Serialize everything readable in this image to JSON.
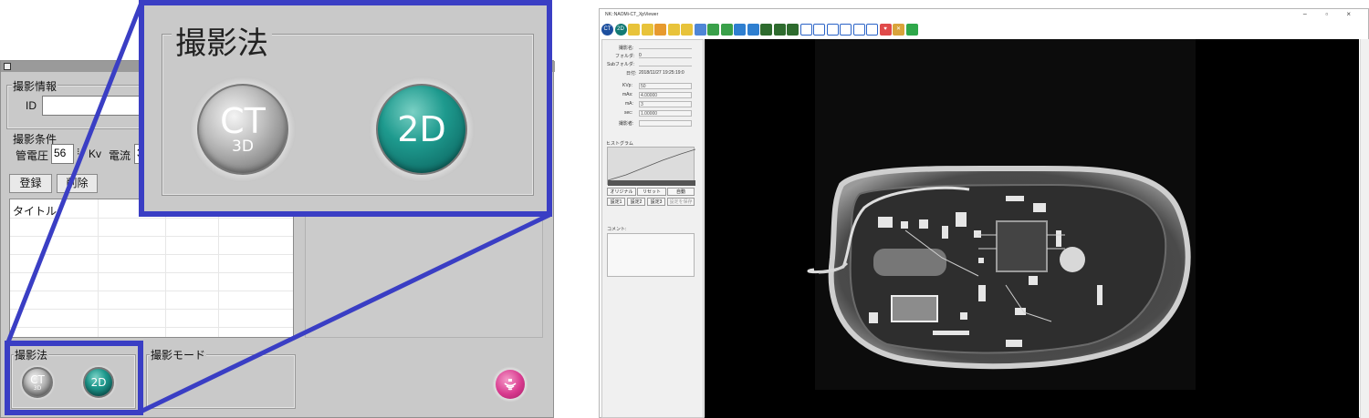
{
  "left_app": {
    "capture_info": {
      "legend": "撮影情報",
      "id_label": "ID"
    },
    "conditions": {
      "legend": "撮影条件",
      "tube_voltage_label": "管電圧",
      "tube_voltage_value": "56",
      "kv_unit": "Kv",
      "current_label": "電流",
      "current_value": "3"
    },
    "buttons": {
      "register": "登録",
      "delete": "削除"
    },
    "table": {
      "title_header": "タイトル"
    },
    "method": {
      "legend": "撮影法",
      "ct_label": "CT",
      "ct_sub": "3D",
      "d2_label": "2D"
    },
    "mode": {
      "legend": "撮影モード"
    }
  },
  "zoom_callout": {
    "legend": "撮影法",
    "ct_label": "CT",
    "ct_sub": "3D",
    "d2_label": "2D"
  },
  "viewer": {
    "window_title": "NK::NAOMi-CT_XpViewer",
    "window_controls": "−  ▫  ×",
    "toolbar_icons": [
      "ct-icon",
      "2d-icon",
      "open-folder-icon",
      "folder-icon",
      "folder-icon",
      "folder-icon",
      "folder-icon",
      "edit-icon",
      "rotate-icon",
      "flip-icon",
      "redo-icon",
      "undo-icon",
      "m-icon",
      "m-icon",
      "m-icon",
      "frame-icon",
      "frame-icon",
      "frame-icon",
      "frame-icon",
      "frame-icon",
      "frame-icon",
      "heart-icon",
      "tools-icon",
      "lock-icon"
    ],
    "info_fields": [
      {
        "label": "撮影名:",
        "value": ""
      },
      {
        "label": "フォルダ:",
        "value": "0"
      },
      {
        "label": "Subフォルダ:",
        "value": ""
      },
      {
        "label": "日付:",
        "value": "2018/11/27 19:25:19:0"
      }
    ],
    "param_fields": [
      {
        "label": "KVp:",
        "value": "50"
      },
      {
        "label": "mAs:",
        "value": "4.00000"
      },
      {
        "label": "mA:",
        "value": "3"
      },
      {
        "label": "sec:",
        "value": "1.00000"
      },
      {
        "label": "撮影者:",
        "value": ""
      }
    ],
    "histogram_label": "ヒストグラム",
    "hist_buttons": [
      "オリジナル",
      "リセット",
      "自動"
    ],
    "preset_buttons": [
      "設定1",
      "設定2",
      "設定3",
      "設定を保存"
    ],
    "comment_label": "コメント:"
  },
  "colors": {
    "highlight": "#3a3ec4",
    "teal": "#1e9a8e",
    "panel_gray": "#c9c9c9"
  }
}
